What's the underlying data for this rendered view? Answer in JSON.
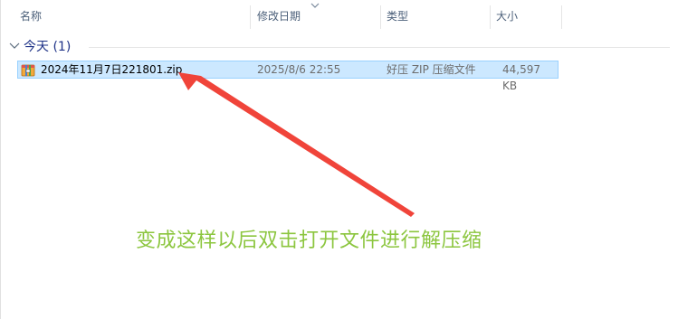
{
  "columns": {
    "name": "名称",
    "date": "修改日期",
    "type": "类型",
    "size": "大小"
  },
  "group": {
    "label": "今天 (1)"
  },
  "files": [
    {
      "name": "2024年11月7日221801.zip",
      "date": "2025/8/6 22:55",
      "type": "好压 ZIP 压缩文件",
      "size": "44,597 KB"
    }
  ],
  "annotation": {
    "text": "变成这样以后双击打开文件进行解压缩",
    "text_color": "#8cc63f",
    "arrow_color": "#f0443a"
  },
  "colors": {
    "selection_bg": "#cce8ff",
    "selection_border": "#99d1ff",
    "header_text": "#4c607a",
    "group_text": "#1e3287"
  },
  "icons": {
    "sort": "chevron-down-icon",
    "group_toggle": "chevron-down-icon",
    "file": "zip-archive-icon"
  }
}
